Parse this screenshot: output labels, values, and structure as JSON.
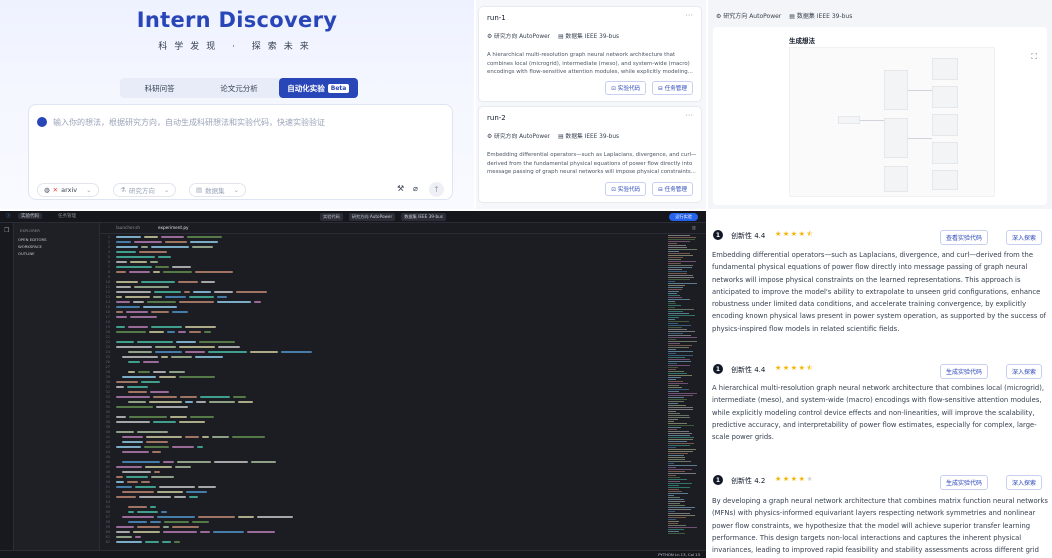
{
  "intern": {
    "title": "Intern Discovery",
    "subtitle": "科学发现 · 探索未来",
    "tabs": [
      "科研问答",
      "论文元分析",
      "自动化实验"
    ],
    "beta": "Beta",
    "placeholder": "输入你的想法，根据研究方向，自动生成科研想法和实验代码，快速实验验证",
    "chip_arxiv": "arxiv",
    "chip_direction": "研究方向",
    "chip_dataset": "数据集"
  },
  "runs": [
    {
      "title": "run-1",
      "direction": "研究方向 AutoPower",
      "dataset": "数据集 IEEE 39-bus",
      "desc": "A hierarchical multi-resolution graph neural network architecture that combines local (microgrid), intermediate (meso), and system-wide (macro) encodings with flow-sensitive attention modules, while explicitly modeling...",
      "btn_code": "实验代码",
      "btn_task": "任务管理"
    },
    {
      "title": "run-2",
      "direction": "研究方向 AutoPower",
      "dataset": "数据集 IEEE 39-bus",
      "desc": "Embedding differential operators—such as Laplacians, divergence, and curl—derived from the fundamental physical equations of power flow directly into message passing of graph neural networks will impose physical constraints...",
      "btn_code": "实验代码",
      "btn_task": "任务管理"
    }
  ],
  "diagram": {
    "direction": "研究方向 AutoPower",
    "dataset": "数据集 IEEE 39-bus",
    "title": "生成想法"
  },
  "ide": {
    "tab_experiment": "实验代码",
    "tab_task": "任务管理",
    "center_code": "实验代码",
    "center_direction": "研究方向 AutoPower",
    "center_dataset": "数据集 IEEE 39-bus",
    "run_btn": "运行实验",
    "explorer": [
      "EXPLORER",
      "OPEN EDITORS",
      "WORKSPACE",
      "OUTLINE"
    ],
    "tabs": [
      "launcher.sh",
      "experiment.py"
    ],
    "status": "PYTHON  Ln 13, Col 13"
  },
  "ideas": [
    {
      "num": "1",
      "score": "创新性 4.4",
      "stars": 4.5,
      "btn1": "查看实验代码",
      "btn2": "深入探索",
      "text": "Embedding differential operators—such as Laplacians, divergence, and curl—derived from the fundamental physical equations of power flow directly into message passing of graph neural networks will impose physical constraints on the learned representations. This approach is anticipated to improve the model's ability to extrapolate to unseen grid configurations, enhance robustness under limited data conditions, and accelerate training convergence, by explicitly encoding known physical laws present in power system operation, as supported by the success of physics-inspired flow models in related scientific fields."
    },
    {
      "num": "1",
      "score": "创新性 4.4",
      "stars": 4.5,
      "btn1": "生成实验代码",
      "btn2": "深入探索",
      "text": "A hierarchical multi-resolution graph neural network architecture that combines local (microgrid), intermediate (meso), and system-wide (macro) encodings with flow-sensitive attention modules, while explicitly modeling control device effects and non-linearities, will improve the scalability, predictive accuracy, and interpretability of power flow estimates, especially for complex, large-scale power grids."
    },
    {
      "num": "1",
      "score": "创新性 4.2",
      "stars": 4,
      "btn1": "生成实验代码",
      "btn2": "深入探索",
      "text": "By developing a graph neural network architecture that combines matrix function neural networks (MFNs) with physics-informed equivariant layers respecting network symmetries and nonlinear power flow constraints, we hypothesize that the model will achieve superior transfer learning performance. This design targets non-local interactions and captures the inherent physical invariances, leading to improved rapid feasibility and stability assessments across different grid"
    }
  ],
  "colors": {
    "brand": "#2946b8",
    "star": "#f5b400",
    "ide_bg": "#1b1d23"
  }
}
